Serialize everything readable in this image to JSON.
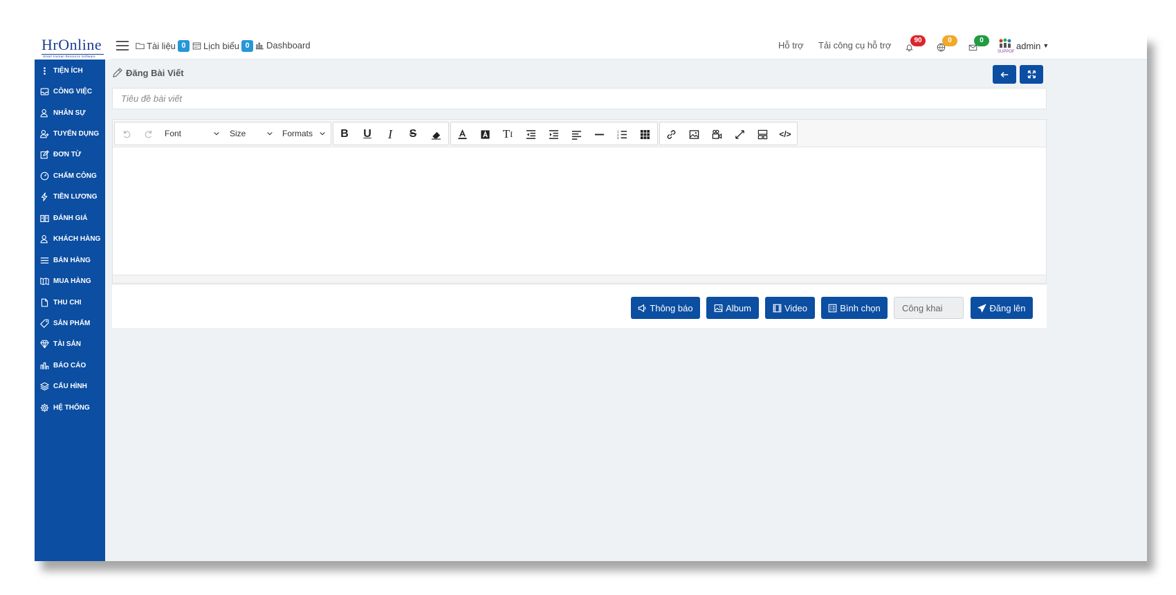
{
  "logo": {
    "text": "HrOnline",
    "subtitle": "Smart Human Resource Software"
  },
  "header": {
    "nav": [
      {
        "label": "Tài liệu",
        "badge": "0",
        "icon": "folder-icon"
      },
      {
        "label": "Lịch biểu",
        "badge": "0",
        "icon": "calendar-icon"
      },
      {
        "label": "Dashboard",
        "icon": "bar-chart-icon"
      }
    ],
    "support_label": "Hỗ trợ",
    "download_label": "Tải công cụ hỗ trợ",
    "notifications": [
      {
        "count": "90",
        "color": "#d9262c",
        "icon": "bell-icon"
      },
      {
        "count": "0",
        "color": "#f0a92a",
        "icon": "globe-icon"
      },
      {
        "count": "0",
        "color": "#229a43",
        "icon": "mail-icon"
      }
    ],
    "user": "admin"
  },
  "sidebar": {
    "items": [
      {
        "label": "TIỆN ÍCH",
        "icon": "more-vertical-icon"
      },
      {
        "label": "CÔNG VIỆC",
        "icon": "inbox-icon"
      },
      {
        "label": "NHÂN SỰ",
        "icon": "user-icon"
      },
      {
        "label": "TUYỂN DỤNG",
        "icon": "user-plus-icon"
      },
      {
        "label": "ĐƠN TỪ",
        "icon": "edit-icon"
      },
      {
        "label": "CHẤM CÔNG",
        "icon": "dashboard-gauge-icon"
      },
      {
        "label": "TIỀN LƯƠNG",
        "icon": "lightning-icon"
      },
      {
        "label": "ĐÁNH GIÁ",
        "icon": "book-icon"
      },
      {
        "label": "KHÁCH HÀNG",
        "icon": "customer-icon"
      },
      {
        "label": "BÁN HÀNG",
        "icon": "list-icon"
      },
      {
        "label": "MUA HÀNG",
        "icon": "map-icon"
      },
      {
        "label": "THU CHI",
        "icon": "file-icon"
      },
      {
        "label": "SẢN PHẨM",
        "icon": "tag-icon"
      },
      {
        "label": "TÀI SẢN",
        "icon": "diamond-icon"
      },
      {
        "label": "BÁO CÁO",
        "icon": "report-chart-icon"
      },
      {
        "label": "CẤU HÌNH",
        "icon": "layers-icon"
      },
      {
        "label": "HỆ THỐNG",
        "icon": "gear-icon"
      }
    ]
  },
  "post": {
    "heading": "Đăng Bài Viết",
    "title_placeholder": "Tiêu đề bài viết",
    "font_select": "Font",
    "size_select": "Size",
    "formats_select": "Formats"
  },
  "actions": {
    "notice": "Thông báo",
    "album": "Album",
    "video": "Video",
    "poll": "Bình chọn",
    "privacy": "Công khai",
    "publish": "Đăng lên"
  },
  "colors": {
    "primary": "#0b4ea2",
    "badge_blue": "#2597d8",
    "background": "#eff2f5"
  }
}
